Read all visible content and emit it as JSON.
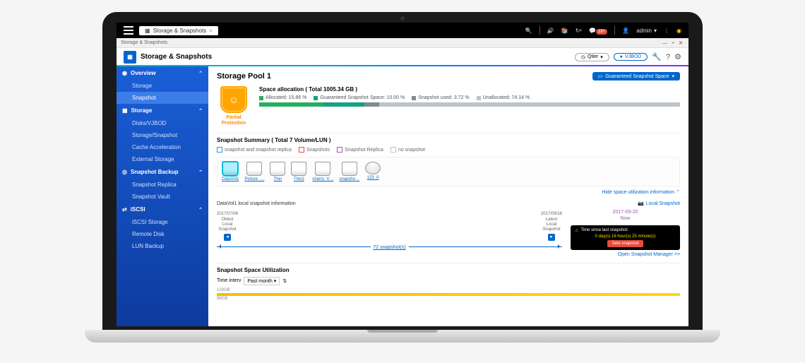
{
  "topbar": {
    "tab_label": "Storage & Snapshots",
    "user_label": "admin",
    "notif_count": "18+"
  },
  "breadcrumb": "Storage & Snapshots",
  "window_controls": {
    "min": "—",
    "max": "+",
    "close": "✕"
  },
  "app_header": {
    "title": "Storage & Snapshots",
    "qtier_btn": "Qtier",
    "vjbod_btn": "VJBOD"
  },
  "sidebar": {
    "overview": {
      "label": "Overview",
      "items": [
        "Storage",
        "Snapshot"
      ]
    },
    "storage": {
      "label": "Storage",
      "items": [
        "Disks/VJBOD",
        "Storage/Snapshot",
        "Cache Acceleration",
        "External Storage"
      ]
    },
    "backup": {
      "label": "Snapshot Backup",
      "items": [
        "Snapshot Replica",
        "Snapshot Vault"
      ]
    },
    "iscsi": {
      "label": "iSCSI",
      "items": [
        "iSCSI Storage",
        "Remote Disk",
        "LUN Backup"
      ]
    },
    "active": "Snapshot"
  },
  "content": {
    "pool_title": "Storage Pool 1",
    "guaranteed_btn": "Guaranteed Snapshot Space",
    "shield_label": "Partial\nProtection",
    "allocation": {
      "title": "Space allocation ( Total 1005.34 GB )",
      "legend": [
        {
          "label": "Allocated: 15.86 %",
          "color": "#27ae60"
        },
        {
          "label": "Guaranteed Snapshot Space: 10.00 %",
          "color": "#16a085"
        },
        {
          "label": "Snapshot used: 3.72 %",
          "color": "#7f8c8d"
        },
        {
          "label": "Unallocated: 74.14 %",
          "color": "#bdc3c7"
        }
      ]
    },
    "summary_title": "Snapshot Summary ( Total 7 Volume/LUN )",
    "filters": [
      {
        "label": "snapshot and snapshot replica",
        "color": "#3498db"
      },
      {
        "label": "Snapshots",
        "color": "#e74c3c"
      },
      {
        "label": "Snapshot Replica",
        "color": "#9b59b6"
      },
      {
        "label": "no snapshot",
        "color": "#bdc3c7"
      }
    ],
    "volumes": [
      "DataVol1",
      "Picture_…",
      "Thin",
      "Thin2",
      "cherry_V…",
      "snapsho…",
      "123_0"
    ],
    "toggle_label": "Hide space utilization information",
    "timeline": {
      "info_label": "DataVol1 local snapshot information",
      "local_label": "Local Snapshot",
      "oldest": {
        "date": "2017/07/06",
        "label": "Oldest\nLocal\nSnapshot"
      },
      "latest": {
        "date": "2017/09/18",
        "label": "Latest\nLocal\nSnapshot"
      },
      "count": "72 snapshot(s)",
      "now_date": "2017-09-20",
      "now_label": "Now",
      "tooltip_label": "Time since last snapshot:",
      "tooltip_time": "0 day(s) 16 hour(s) 25 minute(s)",
      "take_btn": "Take snapshot",
      "manager_link": "Open Snapshot Manager >>"
    },
    "utilization": {
      "title": "Snapshot Space Utilization",
      "interval_label": "Time interv",
      "interval_value": "Past month",
      "y_labels": [
        "120GB",
        "96GB"
      ]
    }
  }
}
